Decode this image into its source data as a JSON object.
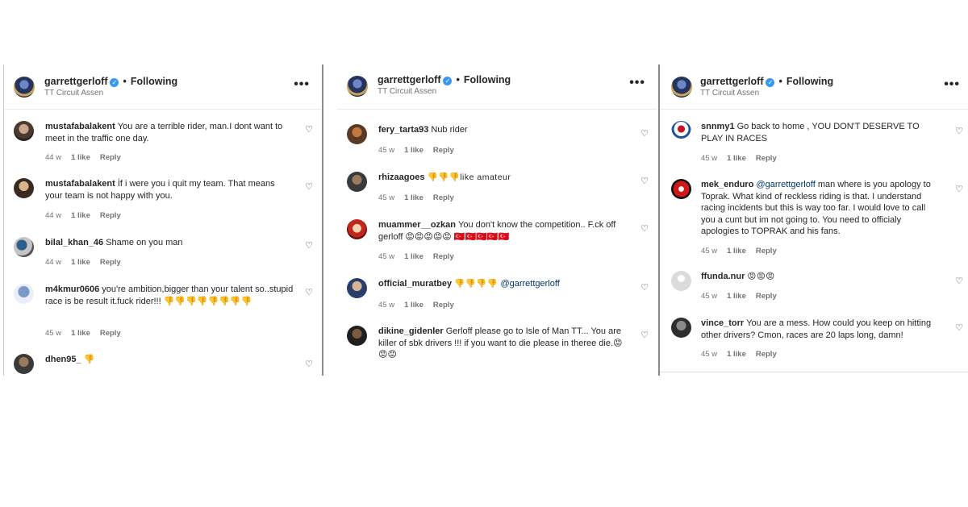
{
  "post": {
    "username": "garrettgerloff",
    "verified_symbol": "✓",
    "separator": "•",
    "following": "Following",
    "location": "TT Circuit Assen",
    "more": "•••"
  },
  "labels": {
    "reply": "Reply",
    "heart": "♡"
  },
  "panels": [
    {
      "comments": [
        {
          "username": "mustafabalakent",
          "text": "You are a terrible rider, man.I dont want to meet in the traffic one day.",
          "age": "44 w",
          "likes": "1 like"
        },
        {
          "username": "mustafabalakent",
          "text": "İf i were you i quit my team. That means your team is not happy with you.",
          "age": "44 w",
          "likes": "1 like"
        },
        {
          "username": "bilal_khan_46",
          "text": "Shame on you man",
          "age": "44 w",
          "likes": "1 like"
        },
        {
          "username": "m4kmur0606",
          "text": "you're ambition,bigger than your talent so..stupid race is be result it.fuck rider!!! 👎👎👎👎👎👎👎👎",
          "age": "45 w",
          "likes": "1 like"
        },
        {
          "username": "dhen95_",
          "text": "👎",
          "age": "",
          "likes": ""
        }
      ]
    },
    {
      "comments": [
        {
          "username": "fery_tarta93",
          "text": "Nub rider",
          "age": "45 w",
          "likes": "1 like"
        },
        {
          "username": "rhizaagoes",
          "text": "👎👎👎like amateur",
          "age": "45 w",
          "likes": "1 like"
        },
        {
          "username": "muammer__ozkan",
          "text": "You don't know the competition.. F.ck off gerloff 😡😡😡😡😡 🇹🇷🇹🇷🇹🇷🇹🇷🇹🇷",
          "age": "45 w",
          "likes": "1 like"
        },
        {
          "username": "official_muratbey",
          "text": "👎👎👎👎",
          "mention": "@garrettgerloff",
          "age": "45 w",
          "likes": "1 like"
        },
        {
          "username": "dikine_gidenler",
          "text": "Gerloff please go to Isle of Man TT... You are killer of sbk drivers !!! if you want to die please in theree die.😡😡😡",
          "age": "",
          "likes": ""
        }
      ]
    },
    {
      "comments": [
        {
          "username": "snnmy1",
          "text": "Go back to home , YOU DON'T DESERVE TO PLAY IN RACES",
          "age": "45 w",
          "likes": "1 like"
        },
        {
          "username": "mek_enduro",
          "mention": "@garrettgerloff",
          "text": "man where is you apology to Toprak. What kind of reckless riding is that. I understand racing incidents but this is way too far. I would love to call you a cunt but im not going to. You need to officialy apologies to TOPRAK and his fans.",
          "age": "45 w",
          "likes": "1 like"
        },
        {
          "username": "ffunda.nur",
          "text": "😡😡😡",
          "age": "45 w",
          "likes": "1 like"
        },
        {
          "username": "vince_torr",
          "text": "You are a mess. How could you keep on hitting other drivers? Cmon, races are 20 laps long, damn!",
          "age": "45 w",
          "likes": "1 like"
        }
      ]
    }
  ]
}
